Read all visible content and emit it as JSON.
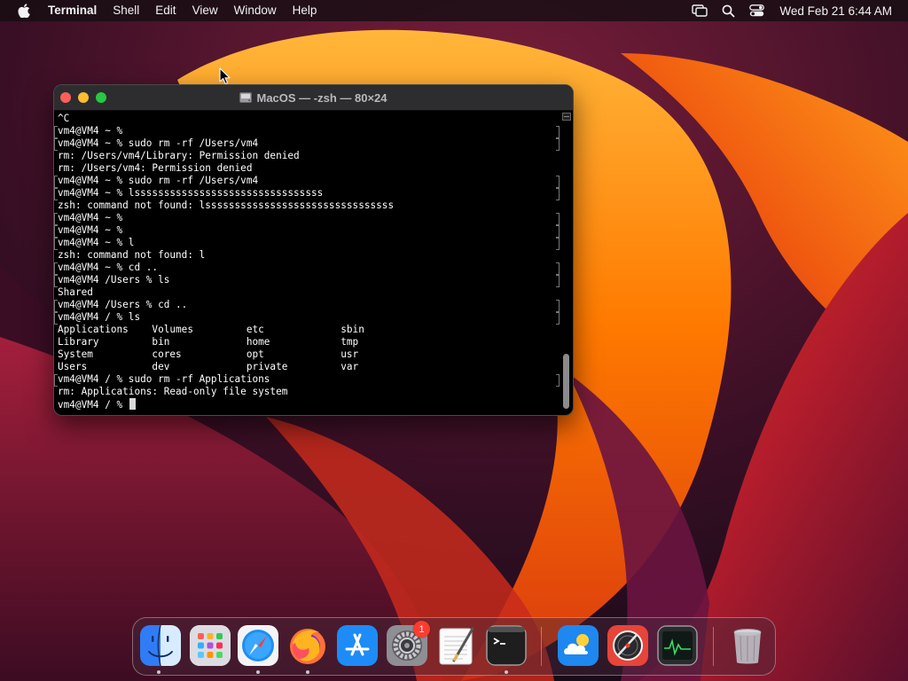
{
  "menubar": {
    "app_name": "Terminal",
    "items": [
      "Shell",
      "Edit",
      "View",
      "Window",
      "Help"
    ],
    "clock": "Wed Feb 21  6:44 AM",
    "status_icons": [
      "screen-mirroring-icon",
      "search-icon",
      "control-center-icon"
    ]
  },
  "window": {
    "title": "MacOS — -zsh — 80×24",
    "lines": [
      {
        "text": "^C",
        "mark": false
      },
      {
        "text": "vm4@VM4 ~ % ",
        "mark": true
      },
      {
        "text": "vm4@VM4 ~ % sudo rm -rf /Users/vm4",
        "mark": true
      },
      {
        "text": "rm: /Users/vm4/Library: Permission denied",
        "mark": false
      },
      {
        "text": "rm: /Users/vm4: Permission denied",
        "mark": false
      },
      {
        "text": "vm4@VM4 ~ % sudo rm -rf /Users/vm4",
        "mark": true
      },
      {
        "text": "vm4@VM4 ~ % lssssssssssssssssssssssssssssssss",
        "mark": true
      },
      {
        "text": "zsh: command not found: lssssssssssssssssssssssssssssssss",
        "mark": false
      },
      {
        "text": "vm4@VM4 ~ % ",
        "mark": true
      },
      {
        "text": "vm4@VM4 ~ % ",
        "mark": true
      },
      {
        "text": "vm4@VM4 ~ % l",
        "mark": true
      },
      {
        "text": "zsh: command not found: l",
        "mark": false
      },
      {
        "text": "vm4@VM4 ~ % cd ..",
        "mark": true
      },
      {
        "text": "vm4@VM4 /Users % ls",
        "mark": true
      },
      {
        "text": "Shared",
        "mark": false
      },
      {
        "text": "vm4@VM4 /Users % cd ..",
        "mark": true
      },
      {
        "text": "vm4@VM4 / % ls",
        "mark": true
      },
      {
        "text": "Applications    Volumes         etc             sbin",
        "mark": false
      },
      {
        "text": "Library         bin             home            tmp",
        "mark": false
      },
      {
        "text": "System          cores           opt             usr",
        "mark": false
      },
      {
        "text": "Users           dev             private         var",
        "mark": false
      },
      {
        "text": "vm4@VM4 / % sudo rm -rf Applications",
        "mark": true
      },
      {
        "text": "rm: Applications: Read-only file system",
        "mark": false
      },
      {
        "text": "vm4@VM4 / % ",
        "mark": false,
        "cursor": true
      }
    ],
    "scroll_position": 0.82
  },
  "dock": {
    "apps": [
      {
        "id": "finder",
        "icon": "finder-icon",
        "running": true
      },
      {
        "id": "launchpad",
        "icon": "launchpad-icon",
        "running": false
      },
      {
        "id": "safari",
        "icon": "safari-icon",
        "running": true
      },
      {
        "id": "firefox",
        "icon": "firefox-icon",
        "running": true
      },
      {
        "id": "app-store",
        "icon": "app-store-icon",
        "running": false
      },
      {
        "id": "system-settings",
        "icon": "gear-icon",
        "running": false,
        "badge": "1"
      },
      {
        "id": "textedit",
        "icon": "textedit-icon",
        "running": false
      },
      {
        "id": "terminal",
        "icon": "terminal-icon",
        "running": true
      },
      {
        "id": "weather",
        "icon": "weather-icon",
        "running": false
      },
      {
        "id": "instruments",
        "icon": "instruments-icon",
        "running": false
      },
      {
        "id": "activity-monitor",
        "icon": "activity-monitor-icon",
        "running": false
      },
      {
        "id": "trash",
        "icon": "trash-icon",
        "running": false
      }
    ]
  },
  "colors": {
    "wallpaper_orange": "#ff8a00",
    "wallpaper_magenta": "#8a1a4a",
    "terminal_bg": "#000000",
    "terminal_text": "#ffffff"
  }
}
